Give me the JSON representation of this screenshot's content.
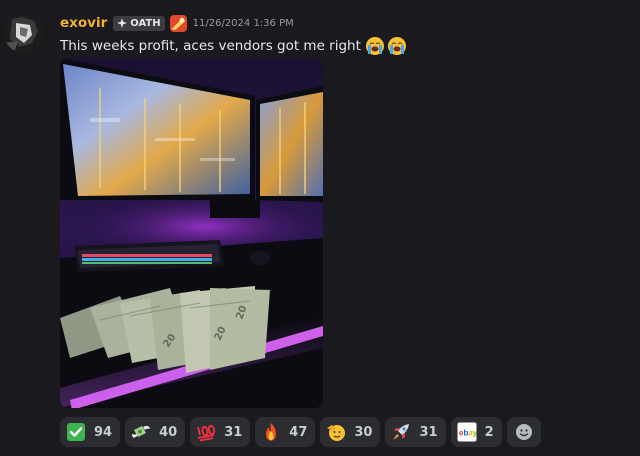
{
  "author": {
    "name": "exovir",
    "tag": "OATH",
    "timestamp": "11/26/2024 1:36 PM"
  },
  "message": {
    "text": "This weeks profit, aces vendors got me right"
  },
  "reactions": [
    {
      "icon": "check-mark-icon",
      "count": "94"
    },
    {
      "icon": "money-with-wings-icon",
      "count": "40"
    },
    {
      "icon": "hundred-points-icon",
      "count": "31"
    },
    {
      "icon": "fire-icon",
      "count": "47"
    },
    {
      "icon": "saluting-face-icon",
      "count": "30"
    },
    {
      "icon": "rocket-icon",
      "count": "31"
    },
    {
      "icon": "ebay-icon",
      "count": "2"
    }
  ],
  "add_reaction": {
    "icon": "add-reaction-icon"
  },
  "colors": {
    "username": "#f0b232",
    "background": "#1a1a1e",
    "reaction_bg": "#2b2d31"
  }
}
